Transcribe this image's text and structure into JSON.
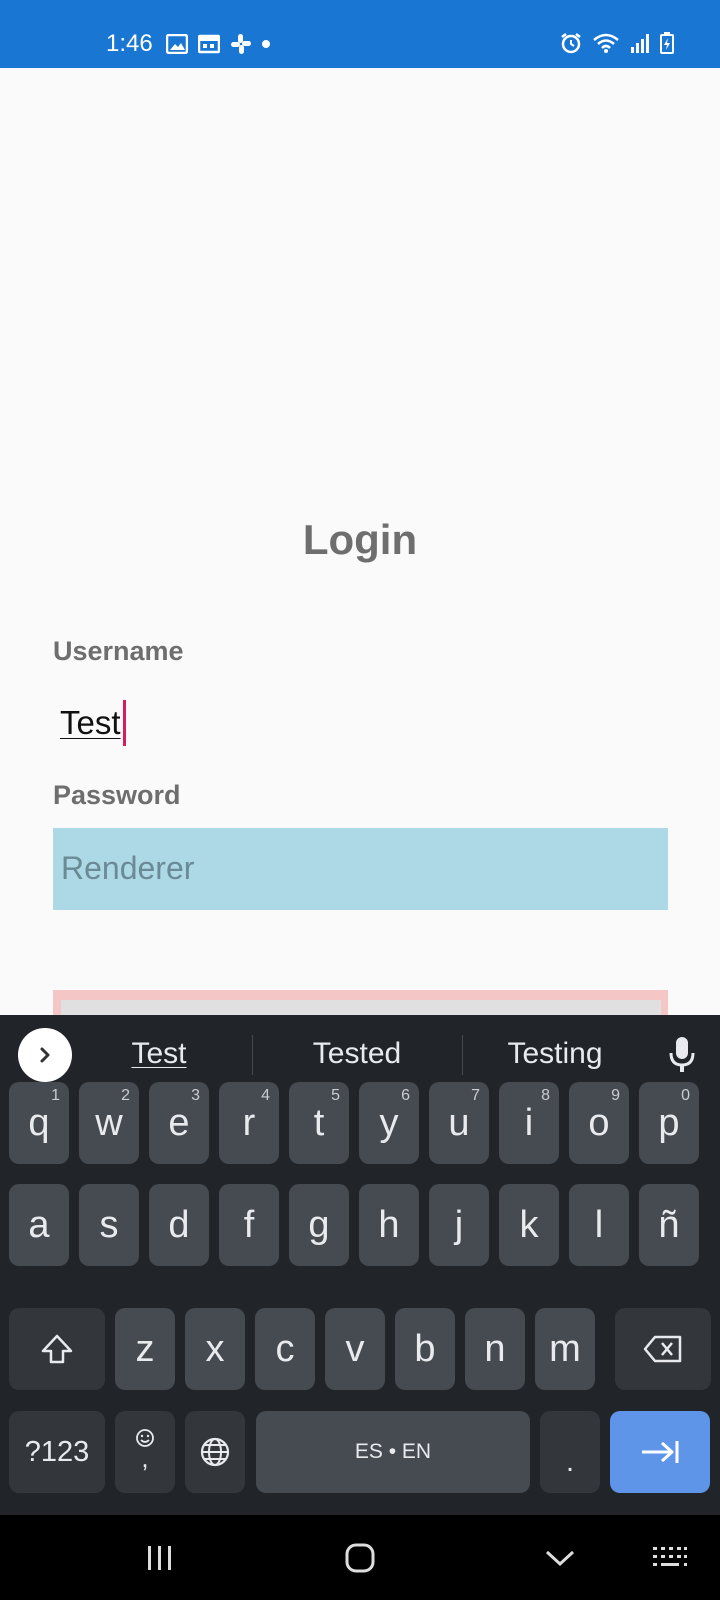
{
  "status_bar": {
    "time": "1:46",
    "background": "#1976d2",
    "left_icons": [
      "image-icon",
      "calendar-icon",
      "slack-icon",
      "dot-icon"
    ],
    "right_icons": [
      "alarm-icon",
      "wifi-icon",
      "signal-icon",
      "battery-charging-icon"
    ]
  },
  "login": {
    "title": "Login",
    "username_label": "Username",
    "username_value": "Test",
    "password_label": "Password",
    "password_placeholder": "Renderer",
    "password_bg": "#add8e6"
  },
  "keyboard": {
    "suggestions": [
      "Test",
      "Tested",
      "Testing"
    ],
    "rows": [
      [
        {
          "k": "q",
          "h": "1"
        },
        {
          "k": "w",
          "h": "2"
        },
        {
          "k": "e",
          "h": "3"
        },
        {
          "k": "r",
          "h": "4"
        },
        {
          "k": "t",
          "h": "5"
        },
        {
          "k": "y",
          "h": "6"
        },
        {
          "k": "u",
          "h": "7"
        },
        {
          "k": "i",
          "h": "8"
        },
        {
          "k": "o",
          "h": "9"
        },
        {
          "k": "p",
          "h": "0"
        }
      ],
      [
        {
          "k": "a"
        },
        {
          "k": "s"
        },
        {
          "k": "d"
        },
        {
          "k": "f"
        },
        {
          "k": "g"
        },
        {
          "k": "h"
        },
        {
          "k": "j"
        },
        {
          "k": "k"
        },
        {
          "k": "l"
        },
        {
          "k": "ñ"
        }
      ],
      [
        {
          "k": "z"
        },
        {
          "k": "x"
        },
        {
          "k": "c"
        },
        {
          "k": "v"
        },
        {
          "k": "b"
        },
        {
          "k": "n"
        },
        {
          "k": "m"
        }
      ]
    ],
    "symbols_key": "?123",
    "comma_key": ",",
    "space_label": "ES • EN",
    "period_key": ".",
    "action_color": "#5f95e8"
  },
  "nav_bar": {
    "icons": [
      "recents-icon",
      "home-icon",
      "back-icon",
      "keyboard-switch-icon"
    ]
  }
}
